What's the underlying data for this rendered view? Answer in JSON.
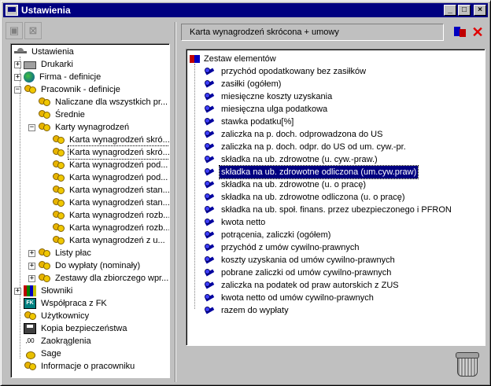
{
  "window": {
    "title": "Ustawienia",
    "buttons": {
      "minimize": "_",
      "maximize": "□",
      "close": "×"
    }
  },
  "left_toolbar": {
    "btn1_icon": "new-item-icon",
    "btn2_icon": "delete-item-icon"
  },
  "tree": {
    "root": "Ustawienia",
    "items": [
      {
        "label": "Drukarki",
        "icon": "printer-icon",
        "expander": "+"
      },
      {
        "label": "Firma - definicje",
        "icon": "globe-icon",
        "expander": "+"
      },
      {
        "label": "Pracownik - definicje",
        "icon": "people-icon",
        "expander": "−"
      },
      {
        "label": "Naliczane dla wszystkich pr...",
        "icon": "people-icon"
      },
      {
        "label": "Średnie",
        "icon": "people-icon"
      },
      {
        "label": "Karty wynagrodzeń",
        "icon": "people-icon",
        "expander": "−"
      },
      {
        "label": "Karta wynagrodzeń skró...",
        "icon": "people-icon"
      },
      {
        "label": "Karta wynagrodzeń skró...",
        "icon": "people-icon",
        "selected": true
      },
      {
        "label": "Karta wynagrodzeń pod...",
        "icon": "people-icon"
      },
      {
        "label": "Karta wynagrodzeń pod...",
        "icon": "people-icon"
      },
      {
        "label": "Karta wynagrodzeń stan...",
        "icon": "people-icon"
      },
      {
        "label": "Karta wynagrodzeń stan...",
        "icon": "people-icon"
      },
      {
        "label": "Karta wynagrodzeń rozb...",
        "icon": "people-icon"
      },
      {
        "label": "Karta wynagrodzeń rozb...",
        "icon": "people-icon"
      },
      {
        "label": "Karta wynagrodzeń z u...",
        "icon": "people-icon"
      },
      {
        "label": "Listy płac",
        "icon": "people-icon",
        "expander": "+"
      },
      {
        "label": "Do wypłaty (nominały)",
        "icon": "people-icon",
        "expander": "+"
      },
      {
        "label": "Zestawy dla zbiorczego wpr...",
        "icon": "people-icon",
        "expander": "+"
      },
      {
        "label": "Słowniki",
        "icon": "books-icon",
        "expander": "+"
      },
      {
        "label": "Współpraca z FK",
        "icon": "fk-icon",
        "fk_text": "FK"
      },
      {
        "label": "Użytkownicy",
        "icon": "users-icon"
      },
      {
        "label": "Kopia bezpieczeństwa",
        "icon": "disk-icon"
      },
      {
        "label": "Zaokrąglenia",
        "icon": "rounding-icon",
        "round_text": ",00"
      },
      {
        "label": "Sage",
        "icon": "sage-icon"
      },
      {
        "label": "Informacje o pracowniku",
        "icon": "people-icon"
      }
    ]
  },
  "right": {
    "header_title": "Karta wynagrodzeń skrócona + umowy",
    "add_icon": "add-element-icon",
    "delete_icon": "delete-element-icon",
    "delete_glyph": "✕",
    "list_root": "Zestaw elementów",
    "elements": [
      "przychód opodatkowany bez zasiłków",
      "zasiłki (ogółem)",
      "miesięczne koszty uzyskania",
      "miesięczna ulga podatkowa",
      "stawka podatku[%]",
      "zaliczka na p. doch. odprowadzona do US",
      "zaliczka na p. doch. odpr. do US od um. cyw.-pr.",
      "składka na ub. zdrowotne (u. cyw.-praw.)",
      "składka na ub. zdrowotne odliczona (um.cyw.praw)",
      "składka na ub. zdrowotne (u. o pracę)",
      "składka na ub. zdrowotne odliczona (u. o pracę)",
      "składka na ub. społ. finans. przez ubezpieczonego i PFRON",
      "kwota netto",
      "potrącenia, zaliczki (ogółem)",
      "przychód z umów cywilno-prawnych",
      "koszty uzyskania od umów cywilno-prawnych",
      "pobrane zaliczki od umów cywilno-prawnych",
      "zaliczka na podatek od praw autorskich z ZUS",
      "kwota netto od umów cywilno-prawnych",
      "razem do wypłaty"
    ],
    "selected_index": 8,
    "trash_icon": "trash-icon"
  }
}
